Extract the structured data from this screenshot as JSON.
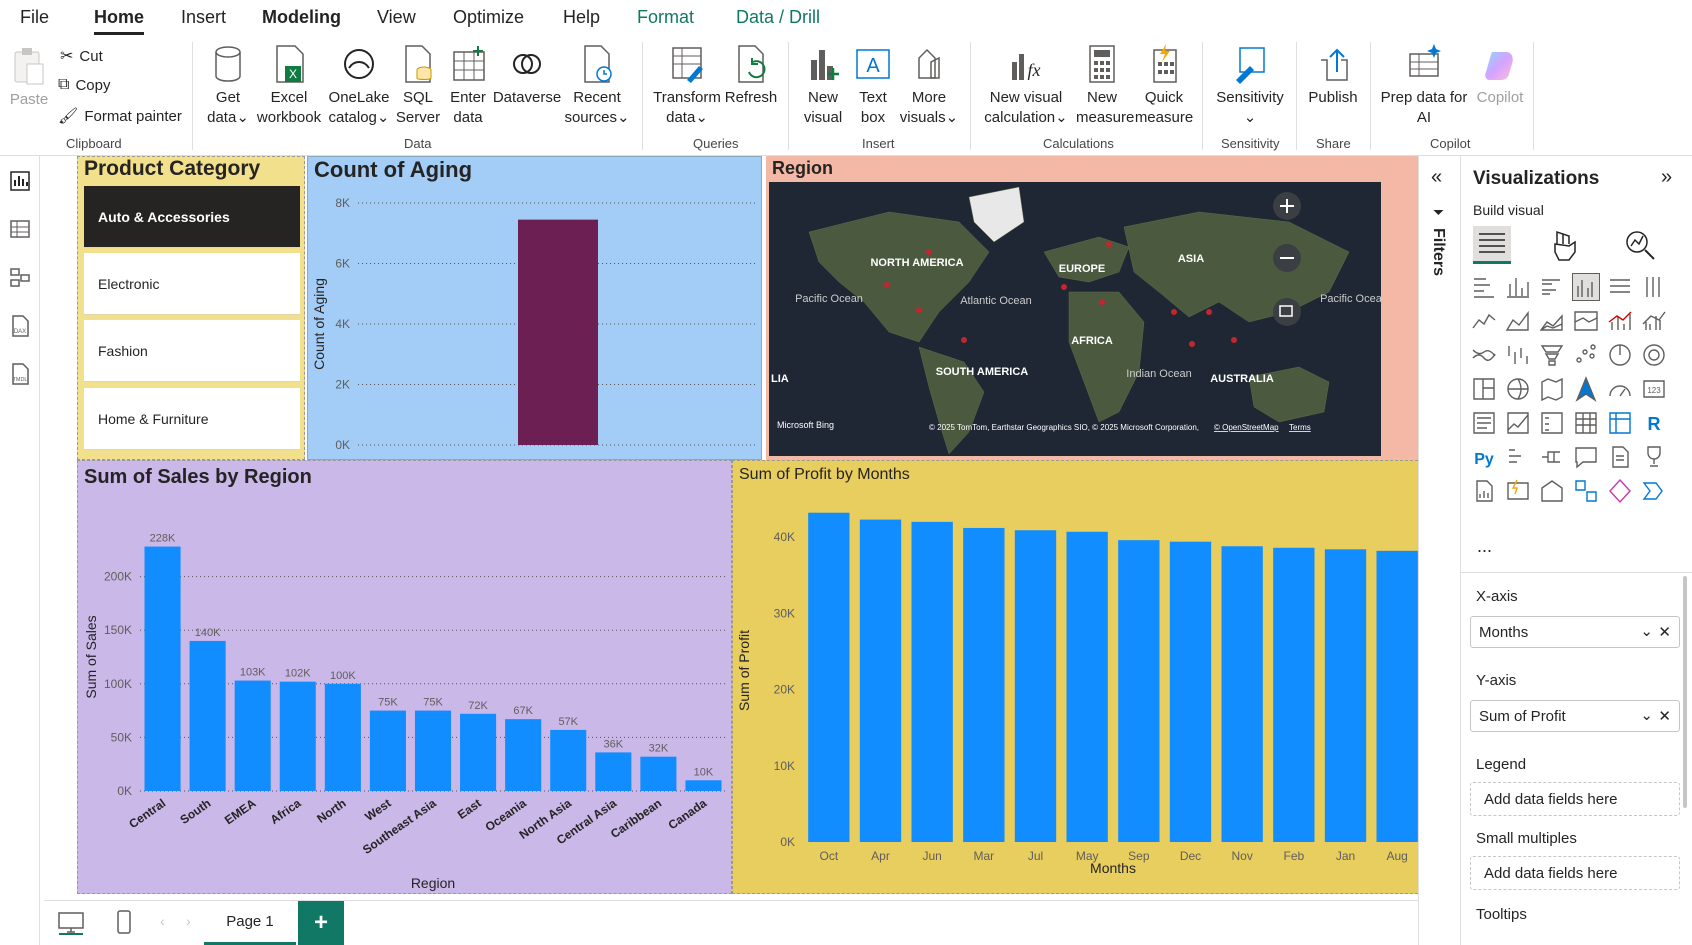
{
  "menu": {
    "items": [
      "File",
      "Home",
      "Insert",
      "Modeling",
      "View",
      "Optimize",
      "Help",
      "Format",
      "Data / Drill"
    ]
  },
  "ribbon": {
    "clipboard": {
      "paste": "Paste",
      "cut": "Cut",
      "copy": "Copy",
      "format_painter": "Format painter",
      "group": "Clipboard"
    },
    "data": {
      "get_data_1": "Get",
      "get_data_2": "data",
      "excel_1": "Excel",
      "excel_2": "workbook",
      "onelake_1": "OneLake",
      "onelake_2": "catalog",
      "sql_1": "SQL",
      "sql_2": "Server",
      "enter_1": "Enter",
      "enter_2": "data",
      "dataverse": "Dataverse",
      "recent_1": "Recent",
      "recent_2": "sources",
      "group": "Data"
    },
    "queries": {
      "transform_1": "Transform",
      "transform_2": "data",
      "refresh": "Refresh",
      "group": "Queries"
    },
    "insert": {
      "newvisual_1": "New",
      "newvisual_2": "visual",
      "textbox_1": "Text",
      "textbox_2": "box",
      "more_1": "More",
      "more_2": "visuals",
      "group": "Insert"
    },
    "calculations": {
      "newcalc_1": "New visual",
      "newcalc_2": "calculation",
      "newmeasure_1": "New",
      "newmeasure_2": "measure",
      "quick_1": "Quick",
      "quick_2": "measure",
      "group": "Calculations"
    },
    "sensitivity": {
      "label": "Sensitivity",
      "group": "Sensitivity"
    },
    "share": {
      "label": "Publish",
      "group": "Share"
    },
    "copilot": {
      "prep_1": "Prep data for",
      "prep_2": "AI",
      "copilot": "Copilot",
      "group": "Copilot"
    }
  },
  "slicer": {
    "title": "Product Category",
    "items": [
      "Auto & Accessories",
      "Electronic",
      "Fashion",
      "Home & Furniture"
    ],
    "selected": 0
  },
  "map": {
    "title": "Region",
    "labels": [
      "NORTH AMERICA",
      "EUROPE",
      "ASIA",
      "AFRICA",
      "SOUTH AMERICA",
      "AUSTRALIA",
      "Pacific Ocean",
      "Atlantic Ocean",
      "Indian Ocean",
      "Pacific Ocean",
      "LIA"
    ],
    "bing": "Microsoft Bing",
    "credits": "© 2025 TomTom, Earthstar Geographics SIO, © 2025 Microsoft Corporation,",
    "osm": "© OpenStreetMap",
    "terms": "Terms"
  },
  "chart_data": [
    {
      "type": "bar",
      "title": "Count of Aging",
      "ylabel": "Count of Aging",
      "xlabel": "",
      "categories": [
        ""
      ],
      "values": [
        7450
      ],
      "ylim": [
        0,
        8000
      ],
      "yticks": [
        0,
        2000,
        4000,
        6000,
        8000
      ],
      "ytick_labels": [
        "0K",
        "2K",
        "4K",
        "6K",
        "8K"
      ],
      "color": "#6b1f52",
      "grid": true
    },
    {
      "type": "bar",
      "title": "Sum of Sales by Region",
      "ylabel": "Sum of Sales",
      "xlabel": "Region",
      "categories": [
        "Central",
        "South",
        "EMEA",
        "Africa",
        "North",
        "West",
        "Southeast Asia",
        "East",
        "Oceania",
        "North Asia",
        "Central Asia",
        "Caribbean",
        "Canada"
      ],
      "values": [
        228000,
        140000,
        103000,
        102000,
        100000,
        75000,
        75000,
        72000,
        67000,
        57000,
        36000,
        32000,
        10000
      ],
      "data_labels": [
        "228K",
        "140K",
        "103K",
        "102K",
        "100K",
        "75K",
        "75K",
        "72K",
        "67K",
        "57K",
        "36K",
        "32K",
        "10K"
      ],
      "ylim": [
        0,
        250000
      ],
      "yticks": [
        0,
        50000,
        100000,
        150000,
        200000
      ],
      "ytick_labels": [
        "0K",
        "50K",
        "100K",
        "150K",
        "200K"
      ],
      "color": "#118dff",
      "grid": true
    },
    {
      "type": "bar",
      "title": "Sum of Profit by Months",
      "ylabel": "Sum of Profit",
      "xlabel": "Months",
      "categories": [
        "Oct",
        "Apr",
        "Jun",
        "Mar",
        "Jul",
        "May",
        "Sep",
        "Dec",
        "Nov",
        "Feb",
        "Jan",
        "Aug"
      ],
      "values": [
        43200,
        42300,
        42000,
        41200,
        40900,
        40700,
        39600,
        39400,
        38800,
        38600,
        38400,
        38200
      ],
      "ylim": [
        0,
        45000
      ],
      "yticks": [
        0,
        10000,
        20000,
        30000,
        40000
      ],
      "ytick_labels": [
        "0K",
        "10K",
        "20K",
        "30K",
        "40K"
      ],
      "color": "#118dff",
      "grid": false
    }
  ],
  "bottom": {
    "page_tab": "Page 1",
    "add": "+"
  },
  "filters": {
    "label": "Filters"
  },
  "viz": {
    "title": "Visualizations",
    "build": "Build visual",
    "more": "...",
    "xaxis_label": "X-axis",
    "xaxis_value": "Months",
    "yaxis_label": "Y-axis",
    "yaxis_value": "Sum of Profit",
    "legend_label": "Legend",
    "legend_placeholder": "Add data fields here",
    "small_label": "Small multiples",
    "small_placeholder": "Add data fields here",
    "tooltips_label": "Tooltips"
  },
  "colors": {
    "accent_green": "#117865",
    "sales_bg": "#c9b8e8",
    "profit_bg": "#e8cd5f",
    "aging_bg": "#a3cdf6",
    "slicer_bg": "#f2e08d",
    "map_border": "#f4b8a6"
  }
}
